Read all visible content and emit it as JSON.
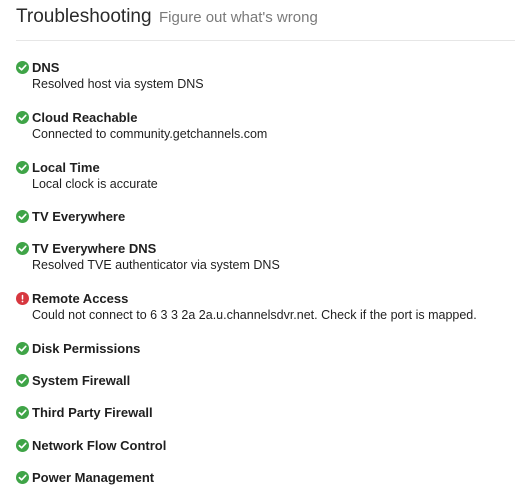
{
  "header": {
    "title": "Troubleshooting",
    "subtitle": "Figure out what's wrong"
  },
  "checks": [
    {
      "name": "DNS",
      "detail": "Resolved host via system DNS",
      "status": "ok",
      "icon": "check-circle-icon"
    },
    {
      "name": "Cloud Reachable",
      "detail": "Connected to community.getchannels.com",
      "status": "ok",
      "icon": "check-circle-icon"
    },
    {
      "name": "Local Time",
      "detail": "Local clock is accurate",
      "status": "ok",
      "icon": "check-circle-icon"
    },
    {
      "name": "TV Everywhere",
      "detail": "",
      "status": "ok",
      "icon": "check-circle-icon"
    },
    {
      "name": "TV Everywhere DNS",
      "detail": "Resolved TVE authenticator via system DNS",
      "status": "ok",
      "icon": "check-circle-icon"
    },
    {
      "name": "Remote Access",
      "detail": "Could not connect to 6 3 3 2a 2a.u.channelsdvr.net. Check if the port is mapped.",
      "status": "error",
      "icon": "error-circle-icon"
    },
    {
      "name": "Disk Permissions",
      "detail": "",
      "status": "ok",
      "icon": "check-circle-icon"
    },
    {
      "name": "System Firewall",
      "detail": "",
      "status": "ok",
      "icon": "check-circle-icon"
    },
    {
      "name": "Third Party Firewall",
      "detail": "",
      "status": "ok",
      "icon": "check-circle-icon"
    },
    {
      "name": "Network Flow Control",
      "detail": "",
      "status": "ok",
      "icon": "check-circle-icon"
    },
    {
      "name": "Power Management",
      "detail": "",
      "status": "ok",
      "icon": "check-circle-icon"
    }
  ],
  "colors": {
    "ok": "#3fa447",
    "error": "#d7373f"
  }
}
